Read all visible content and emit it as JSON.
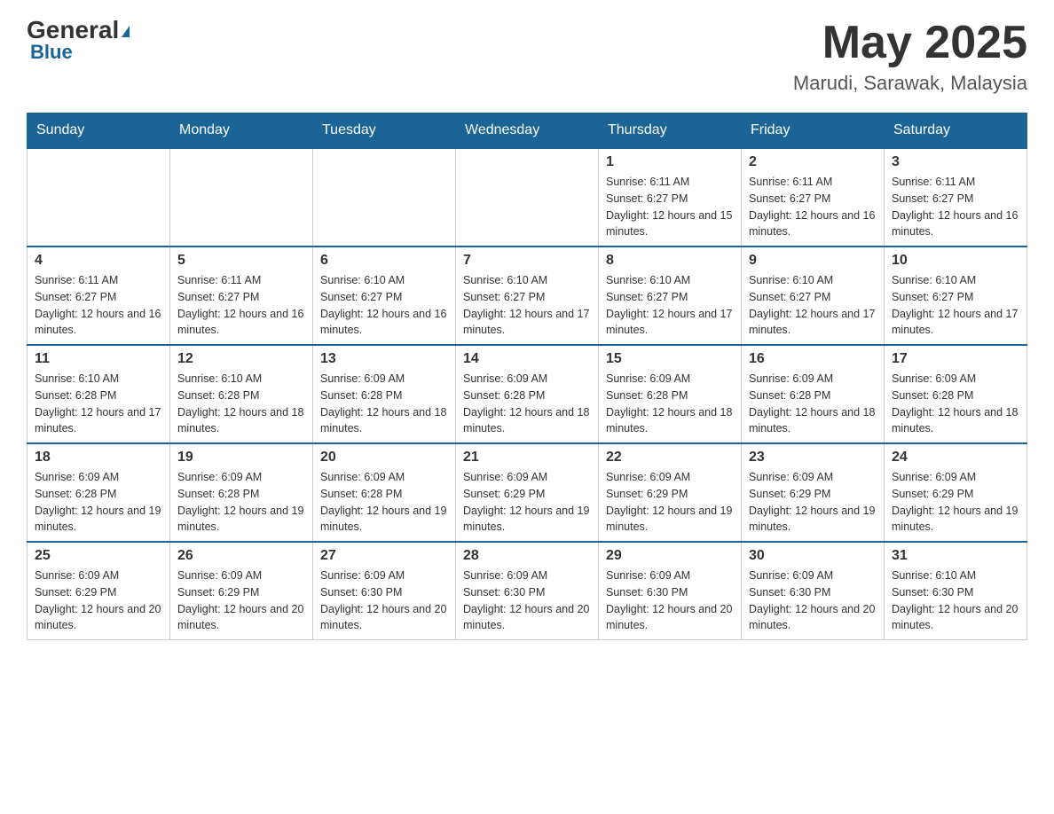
{
  "header": {
    "logo": {
      "general": "General",
      "blue": "Blue"
    },
    "title": "May 2025",
    "location": "Marudi, Sarawak, Malaysia"
  },
  "calendar": {
    "days_of_week": [
      "Sunday",
      "Monday",
      "Tuesday",
      "Wednesday",
      "Thursday",
      "Friday",
      "Saturday"
    ],
    "weeks": [
      [
        {
          "day": "",
          "info": ""
        },
        {
          "day": "",
          "info": ""
        },
        {
          "day": "",
          "info": ""
        },
        {
          "day": "",
          "info": ""
        },
        {
          "day": "1",
          "info": "Sunrise: 6:11 AM\nSunset: 6:27 PM\nDaylight: 12 hours and 15 minutes."
        },
        {
          "day": "2",
          "info": "Sunrise: 6:11 AM\nSunset: 6:27 PM\nDaylight: 12 hours and 16 minutes."
        },
        {
          "day": "3",
          "info": "Sunrise: 6:11 AM\nSunset: 6:27 PM\nDaylight: 12 hours and 16 minutes."
        }
      ],
      [
        {
          "day": "4",
          "info": "Sunrise: 6:11 AM\nSunset: 6:27 PM\nDaylight: 12 hours and 16 minutes."
        },
        {
          "day": "5",
          "info": "Sunrise: 6:11 AM\nSunset: 6:27 PM\nDaylight: 12 hours and 16 minutes."
        },
        {
          "day": "6",
          "info": "Sunrise: 6:10 AM\nSunset: 6:27 PM\nDaylight: 12 hours and 16 minutes."
        },
        {
          "day": "7",
          "info": "Sunrise: 6:10 AM\nSunset: 6:27 PM\nDaylight: 12 hours and 17 minutes."
        },
        {
          "day": "8",
          "info": "Sunrise: 6:10 AM\nSunset: 6:27 PM\nDaylight: 12 hours and 17 minutes."
        },
        {
          "day": "9",
          "info": "Sunrise: 6:10 AM\nSunset: 6:27 PM\nDaylight: 12 hours and 17 minutes."
        },
        {
          "day": "10",
          "info": "Sunrise: 6:10 AM\nSunset: 6:27 PM\nDaylight: 12 hours and 17 minutes."
        }
      ],
      [
        {
          "day": "11",
          "info": "Sunrise: 6:10 AM\nSunset: 6:28 PM\nDaylight: 12 hours and 17 minutes."
        },
        {
          "day": "12",
          "info": "Sunrise: 6:10 AM\nSunset: 6:28 PM\nDaylight: 12 hours and 18 minutes."
        },
        {
          "day": "13",
          "info": "Sunrise: 6:09 AM\nSunset: 6:28 PM\nDaylight: 12 hours and 18 minutes."
        },
        {
          "day": "14",
          "info": "Sunrise: 6:09 AM\nSunset: 6:28 PM\nDaylight: 12 hours and 18 minutes."
        },
        {
          "day": "15",
          "info": "Sunrise: 6:09 AM\nSunset: 6:28 PM\nDaylight: 12 hours and 18 minutes."
        },
        {
          "day": "16",
          "info": "Sunrise: 6:09 AM\nSunset: 6:28 PM\nDaylight: 12 hours and 18 minutes."
        },
        {
          "day": "17",
          "info": "Sunrise: 6:09 AM\nSunset: 6:28 PM\nDaylight: 12 hours and 18 minutes."
        }
      ],
      [
        {
          "day": "18",
          "info": "Sunrise: 6:09 AM\nSunset: 6:28 PM\nDaylight: 12 hours and 19 minutes."
        },
        {
          "day": "19",
          "info": "Sunrise: 6:09 AM\nSunset: 6:28 PM\nDaylight: 12 hours and 19 minutes."
        },
        {
          "day": "20",
          "info": "Sunrise: 6:09 AM\nSunset: 6:28 PM\nDaylight: 12 hours and 19 minutes."
        },
        {
          "day": "21",
          "info": "Sunrise: 6:09 AM\nSunset: 6:29 PM\nDaylight: 12 hours and 19 minutes."
        },
        {
          "day": "22",
          "info": "Sunrise: 6:09 AM\nSunset: 6:29 PM\nDaylight: 12 hours and 19 minutes."
        },
        {
          "day": "23",
          "info": "Sunrise: 6:09 AM\nSunset: 6:29 PM\nDaylight: 12 hours and 19 minutes."
        },
        {
          "day": "24",
          "info": "Sunrise: 6:09 AM\nSunset: 6:29 PM\nDaylight: 12 hours and 19 minutes."
        }
      ],
      [
        {
          "day": "25",
          "info": "Sunrise: 6:09 AM\nSunset: 6:29 PM\nDaylight: 12 hours and 20 minutes."
        },
        {
          "day": "26",
          "info": "Sunrise: 6:09 AM\nSunset: 6:29 PM\nDaylight: 12 hours and 20 minutes."
        },
        {
          "day": "27",
          "info": "Sunrise: 6:09 AM\nSunset: 6:30 PM\nDaylight: 12 hours and 20 minutes."
        },
        {
          "day": "28",
          "info": "Sunrise: 6:09 AM\nSunset: 6:30 PM\nDaylight: 12 hours and 20 minutes."
        },
        {
          "day": "29",
          "info": "Sunrise: 6:09 AM\nSunset: 6:30 PM\nDaylight: 12 hours and 20 minutes."
        },
        {
          "day": "30",
          "info": "Sunrise: 6:09 AM\nSunset: 6:30 PM\nDaylight: 12 hours and 20 minutes."
        },
        {
          "day": "31",
          "info": "Sunrise: 6:10 AM\nSunset: 6:30 PM\nDaylight: 12 hours and 20 minutes."
        }
      ]
    ]
  }
}
